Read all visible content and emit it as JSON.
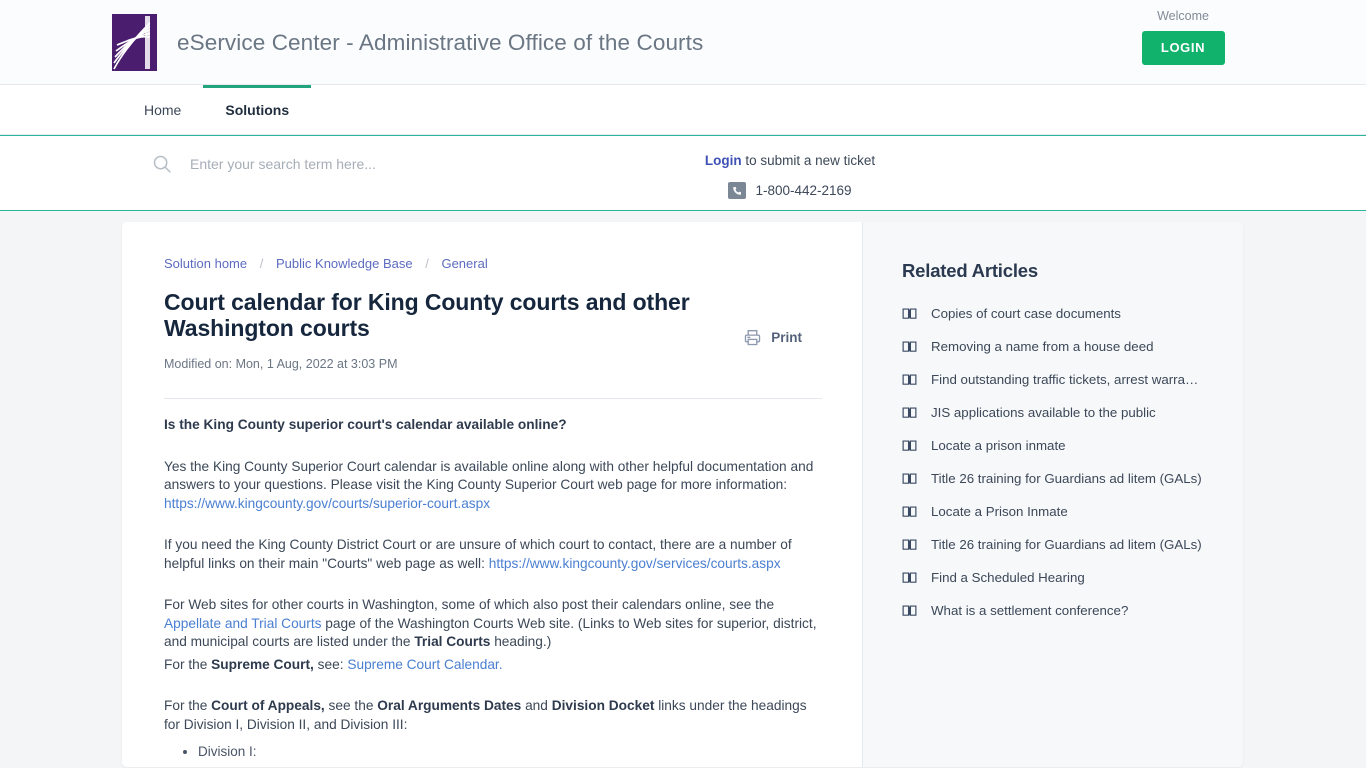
{
  "header": {
    "brand_title": "eService Center - Administrative Office of the Courts",
    "logo_name": "aoc-fan-logo",
    "welcome_text": "Welcome",
    "login_label": "LOGIN",
    "accent_green": "#11b26c",
    "logo_purple": "#4a1d6e"
  },
  "nav": {
    "items": [
      {
        "label": "Home",
        "active": false
      },
      {
        "label": "Solutions",
        "active": true
      }
    ],
    "active_underline_color": "#24a47c"
  },
  "search": {
    "placeholder": "Enter your search term here...",
    "value": "",
    "band_border_color": "#2bb699",
    "ticket_link_label": "Login",
    "ticket_text": " to submit a new ticket",
    "phone": "1-800-442-2169"
  },
  "breadcrumb": {
    "items": [
      "Solution home",
      "Public Knowledge Base",
      "General"
    ],
    "separator": "/"
  },
  "article": {
    "title": "Court calendar for King County courts and other Washington courts",
    "modified": "Modified on: Mon, 1 Aug, 2022 at 3:03 PM",
    "print_label": "Print",
    "question": "Is the King County superior court's calendar available online?",
    "p1_text": "Yes the King County Superior Court calendar is available online along with other helpful documentation and answers to your questions.  Please visit the King County Superior Court web page for more information: ",
    "p1_link": "https://www.kingcounty.gov/courts/superior-court.aspx",
    "p2_text": "If you need the King County District Court or are unsure of which court to contact, there are a number of helpful links on their main \"Courts\" web page as well: ",
    "p2_link": "https://www.kingcounty.gov/services/courts.aspx",
    "p3_a": "For Web sites for other courts in Washington, some of which also post their calendars online, see the ",
    "p3_link": "Appellate and Trial Courts",
    "p3_b": " page of the Washington Courts Web site.  (Links to Web sites for superior, district, and municipal courts are listed under the ",
    "p3_bold": "Trial Courts",
    "p3_c": " heading.)",
    "p4_a": "For the ",
    "p4_bold": "Supreme Court,",
    "p4_b": " see: ",
    "p4_link": "Supreme Court Calendar.",
    "p5_a": "For the ",
    "p5_bold1": "Court of Appeals,",
    "p5_b": " see the ",
    "p5_bold2": "Oral Arguments Dates",
    "p5_c": " and ",
    "p5_bold3": "Division Docket",
    "p5_d": " links under the headings for Division I, Division II, and Division III:",
    "bullets": [
      "Division I:"
    ]
  },
  "aside": {
    "title": "Related Articles",
    "items": [
      "Copies of court case documents",
      "Removing a name from a house deed",
      "Find outstanding traffic tickets, arrest warra…",
      "JIS applications available to the public",
      "Locate a prison inmate",
      "Title 26 training for Guardians ad litem (GALs)",
      "Locate a Prison Inmate",
      "Title 26 training for Guardians ad litem (GALs)",
      "Find a Scheduled Hearing",
      "What is a settlement conference?"
    ],
    "icon_name": "book-icon"
  }
}
